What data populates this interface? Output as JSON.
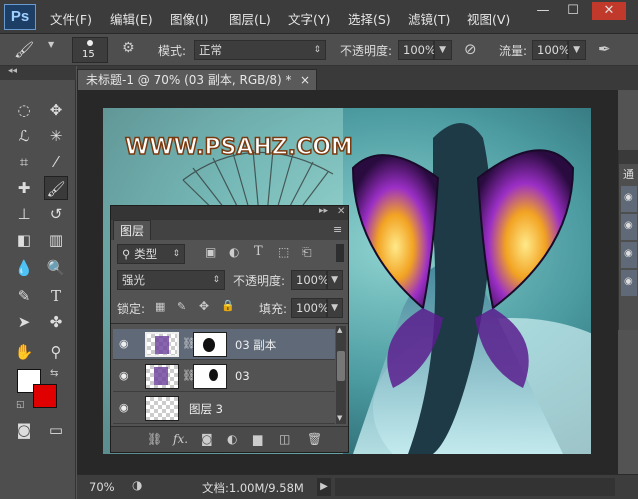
{
  "app": {
    "logo": "Ps"
  },
  "menu": [
    "文件(F)",
    "编辑(E)",
    "图像(I)",
    "图层(L)",
    "文字(Y)",
    "选择(S)",
    "滤镜(T)",
    "视图(V)"
  ],
  "window_controls": {
    "minimize": "—",
    "restore": "☐",
    "close": "✕"
  },
  "options": {
    "brush_size": "15",
    "mode_label": "模式:",
    "mode_value": "正常",
    "opacity_label": "不透明度:",
    "opacity_value": "100%",
    "flow_label": "流量:",
    "flow_value": "100%"
  },
  "document": {
    "tab_title": "未标题-1 @ 70% (03 副本, RGB/8) *",
    "tab_close": "×"
  },
  "canvas": {
    "watermark": "WWW.PSAHZ.COM"
  },
  "status": {
    "zoom": "70%",
    "doc_info": "文档:1.00M/9.58M"
  },
  "right_dock": {
    "tab_label": "通"
  },
  "layers_panel": {
    "tab": "图层",
    "filter_label": "类型",
    "blend_mode": "强光",
    "opacity_label": "不透明度:",
    "opacity_value": "100%",
    "lock_label": "锁定:",
    "fill_label": "填充:",
    "fill_value": "100%",
    "layers": [
      {
        "name": "03 副本",
        "active": true
      },
      {
        "name": "03",
        "active": false
      },
      {
        "name": "图层 3",
        "active": false
      }
    ],
    "bottom_icons": [
      "link-icon",
      "fx-icon",
      "mask-icon",
      "adjustment-icon",
      "group-folder-icon",
      "new-layer-icon",
      "trash-icon"
    ],
    "fx_label": "fx."
  },
  "colors": {
    "foreground": "#ffffff",
    "background": "#e00000",
    "active_layer": "#5f6978"
  }
}
